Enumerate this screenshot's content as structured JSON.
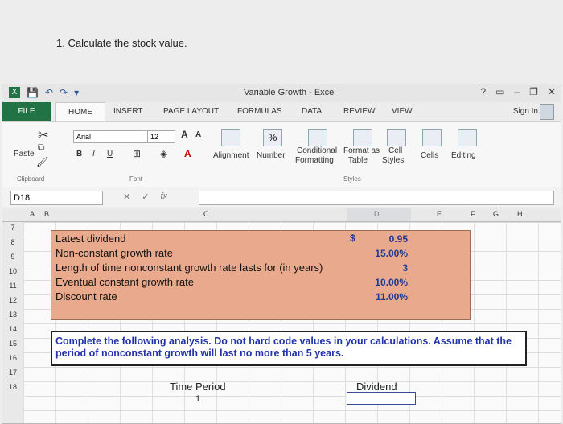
{
  "question": "1. Calculate the stock value.",
  "window": {
    "title": "Variable Growth - Excel",
    "help": "?",
    "sign_in": "Sign In"
  },
  "tabs": [
    "FILE",
    "HOME",
    "INSERT",
    "PAGE LAYOUT",
    "FORMULAS",
    "DATA",
    "REVIEW",
    "VIEW"
  ],
  "ribbon": {
    "paste": "Paste",
    "font_name": "Arial",
    "font_size": "12",
    "font_grow": "A",
    "font_shrink": "A",
    "bold": "B",
    "italic": "I",
    "underline": "U",
    "alignment": "Alignment",
    "percent": "%",
    "number": "Number",
    "conditional": "Conditional",
    "formatting": "Formatting",
    "format_as": "Format as",
    "table": "Table",
    "cell": "Cell",
    "styles": "Styles",
    "cells": "Cells",
    "editing": "Editing",
    "grp_clipboard": "Clipboard",
    "grp_font": "Font",
    "grp_styles": "Styles"
  },
  "formula_bar": {
    "name_box": "D18",
    "cancel": "✕",
    "enter": "✓",
    "fx": "fx",
    "content": ""
  },
  "columns": [
    "A",
    "B",
    "C",
    "D",
    "E",
    "F",
    "G",
    "H"
  ],
  "rows": [
    "7",
    "8",
    "9",
    "10",
    "11",
    "12",
    "13",
    "14",
    "15",
    "16",
    "17",
    "18"
  ],
  "inputs": [
    {
      "label": "Latest dividend",
      "value": "0.95"
    },
    {
      "label": "Non-constant growth rate",
      "value": "15.00%"
    },
    {
      "label": "Length of time nonconstant growth rate lasts for (in years)",
      "value": "3"
    },
    {
      "label": "Eventual constant growth rate",
      "value": "10.00%"
    },
    {
      "label": "Discount rate",
      "value": "11.00%"
    }
  ],
  "dollar_sign": "$",
  "note": "Complete the following analysis. Do not hard code values in your calculations. Assume that the period of nonconstant growth will last no more than 5 years.",
  "table_headers": {
    "time_period": "Time Period",
    "dividend": "Dividend"
  },
  "first_period": "1"
}
